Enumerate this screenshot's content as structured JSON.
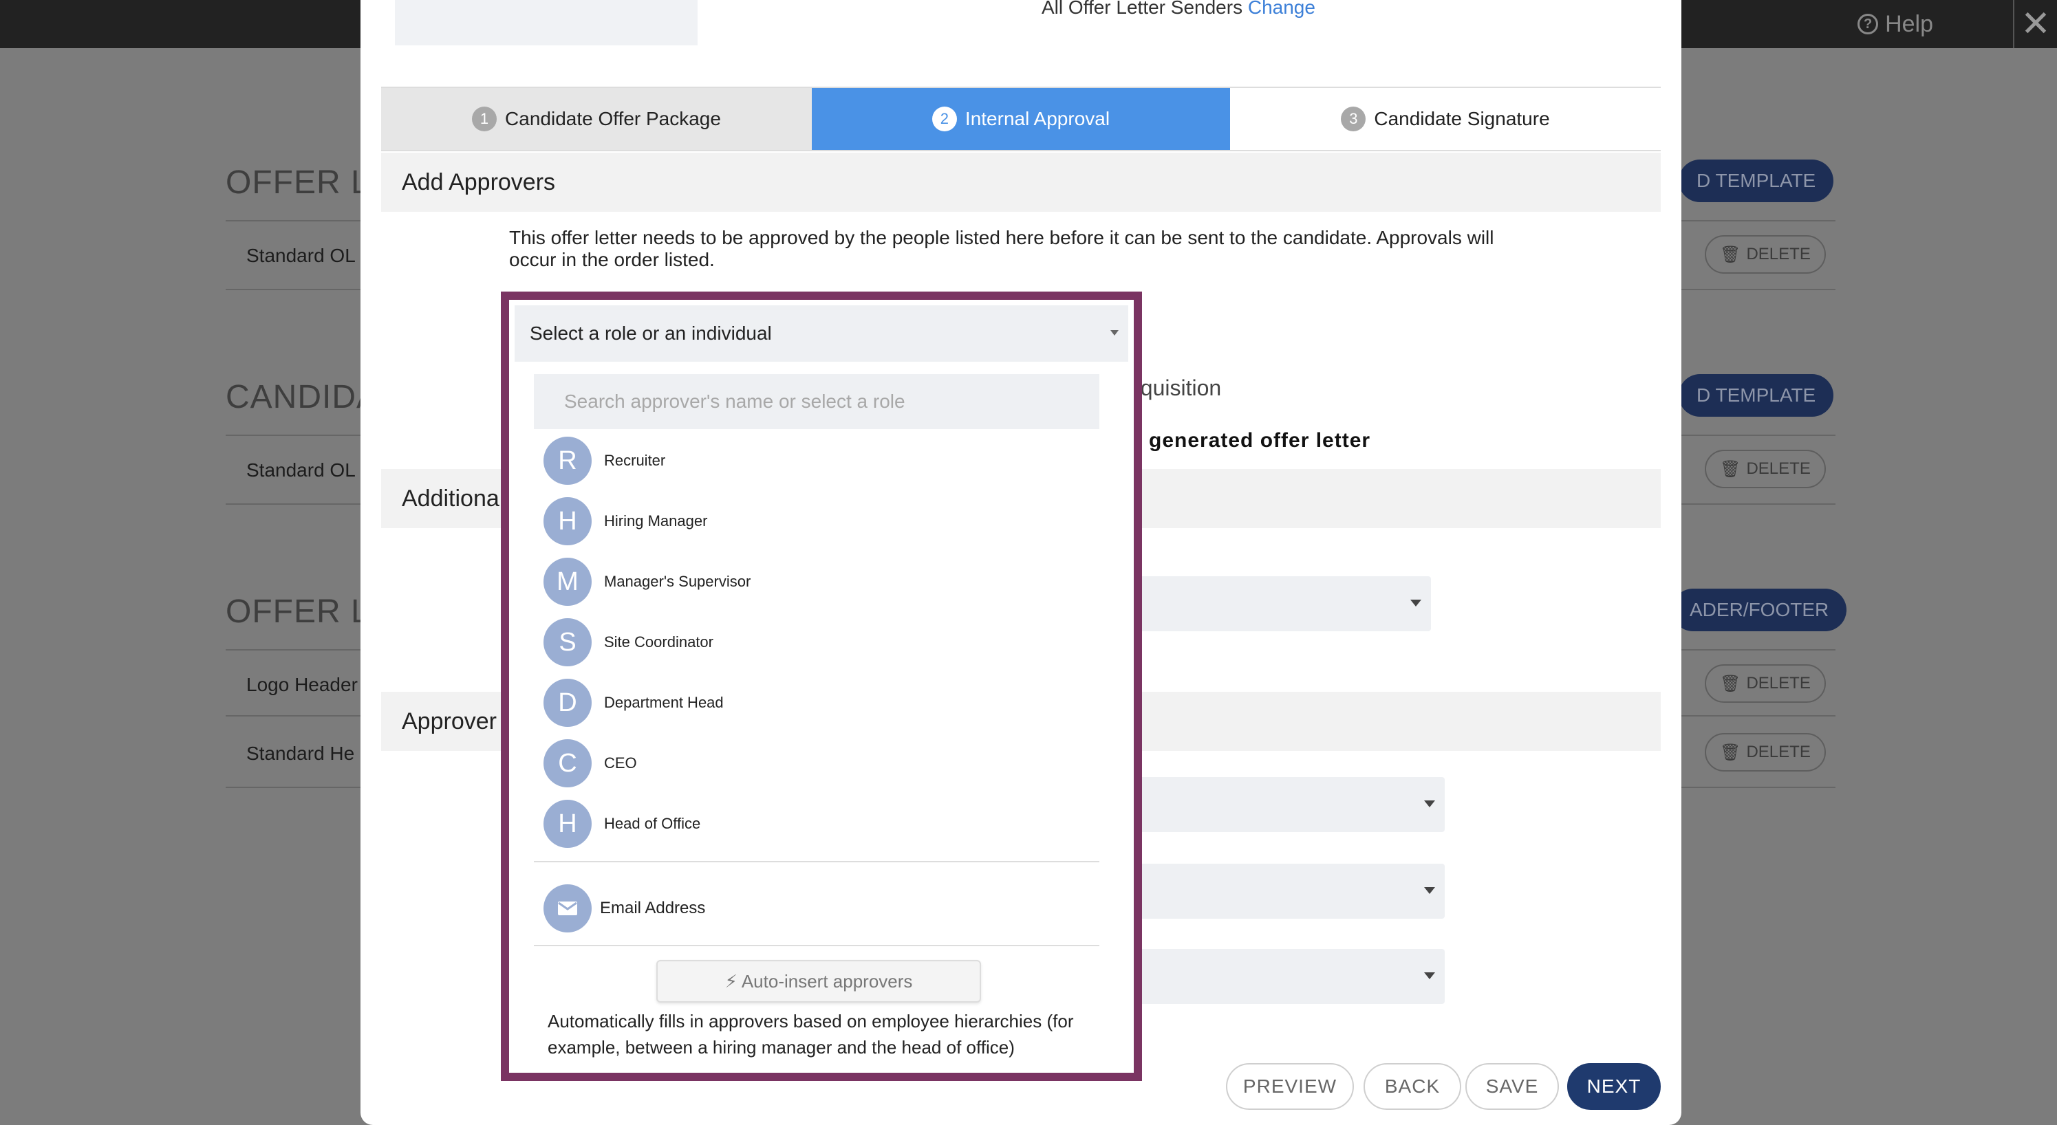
{
  "topbar": {
    "help_label": "Help",
    "help_icon": "question-circle-icon",
    "close_icon": "close-icon"
  },
  "background": {
    "sections": [
      {
        "title": "OFFER LE",
        "button": "D TEMPLATE",
        "rows": [
          "Standard OL"
        ]
      },
      {
        "title": "CANDIDA",
        "button": "D TEMPLATE",
        "rows": [
          "Standard OL"
        ]
      },
      {
        "title": "OFFER LE",
        "button": "ADER/FOOTER",
        "rows": [
          "Logo Header",
          "Standard He"
        ]
      }
    ],
    "delete_label": "DELETE"
  },
  "modal": {
    "senders_text": "All Offer Letter Senders",
    "senders_link": "Change",
    "steps": [
      {
        "num": "1",
        "label": "Candidate Offer Package"
      },
      {
        "num": "2",
        "label": "Internal Approval"
      },
      {
        "num": "3",
        "label": "Candidate Signature"
      }
    ],
    "add_approvers_title": "Add Approvers",
    "description": "This offer letter needs to be approved by the people listed here before it can be sent to the candidate. Approvals will occur in the order listed.",
    "additional_title": "Additiona",
    "approvers_title": "Approver",
    "behind_requisition": "equisition",
    "behind_generated": "generated offer letter",
    "footer": {
      "preview": "PREVIEW",
      "back": "BACK",
      "save": "SAVE",
      "next": "NEXT"
    }
  },
  "dropdown": {
    "selected": "Select a role or an individual",
    "search_placeholder": "Search approver's name or select a role",
    "roles": [
      {
        "initial": "R",
        "label": "Recruiter"
      },
      {
        "initial": "H",
        "label": "Hiring Manager"
      },
      {
        "initial": "M",
        "label": "Manager's Supervisor"
      },
      {
        "initial": "S",
        "label": "Site Coordinator"
      },
      {
        "initial": "D",
        "label": "Department Head"
      },
      {
        "initial": "C",
        "label": "CEO"
      },
      {
        "initial": "H",
        "label": "Head of Office"
      }
    ],
    "email_label": "Email Address",
    "email_icon": "envelope-icon",
    "auto_insert_label": "Auto-insert approvers",
    "auto_insert_icon": "lightning-bolt-icon",
    "auto_insert_desc": "Automatically fills in approvers based on employee hierarchies (for example, between a hiring manager and the head of office)"
  },
  "colors": {
    "highlight_border": "#7a3462",
    "active_step": "#4a92e6",
    "avatar": "#9aaed3",
    "next_button": "#1f3a6e"
  }
}
